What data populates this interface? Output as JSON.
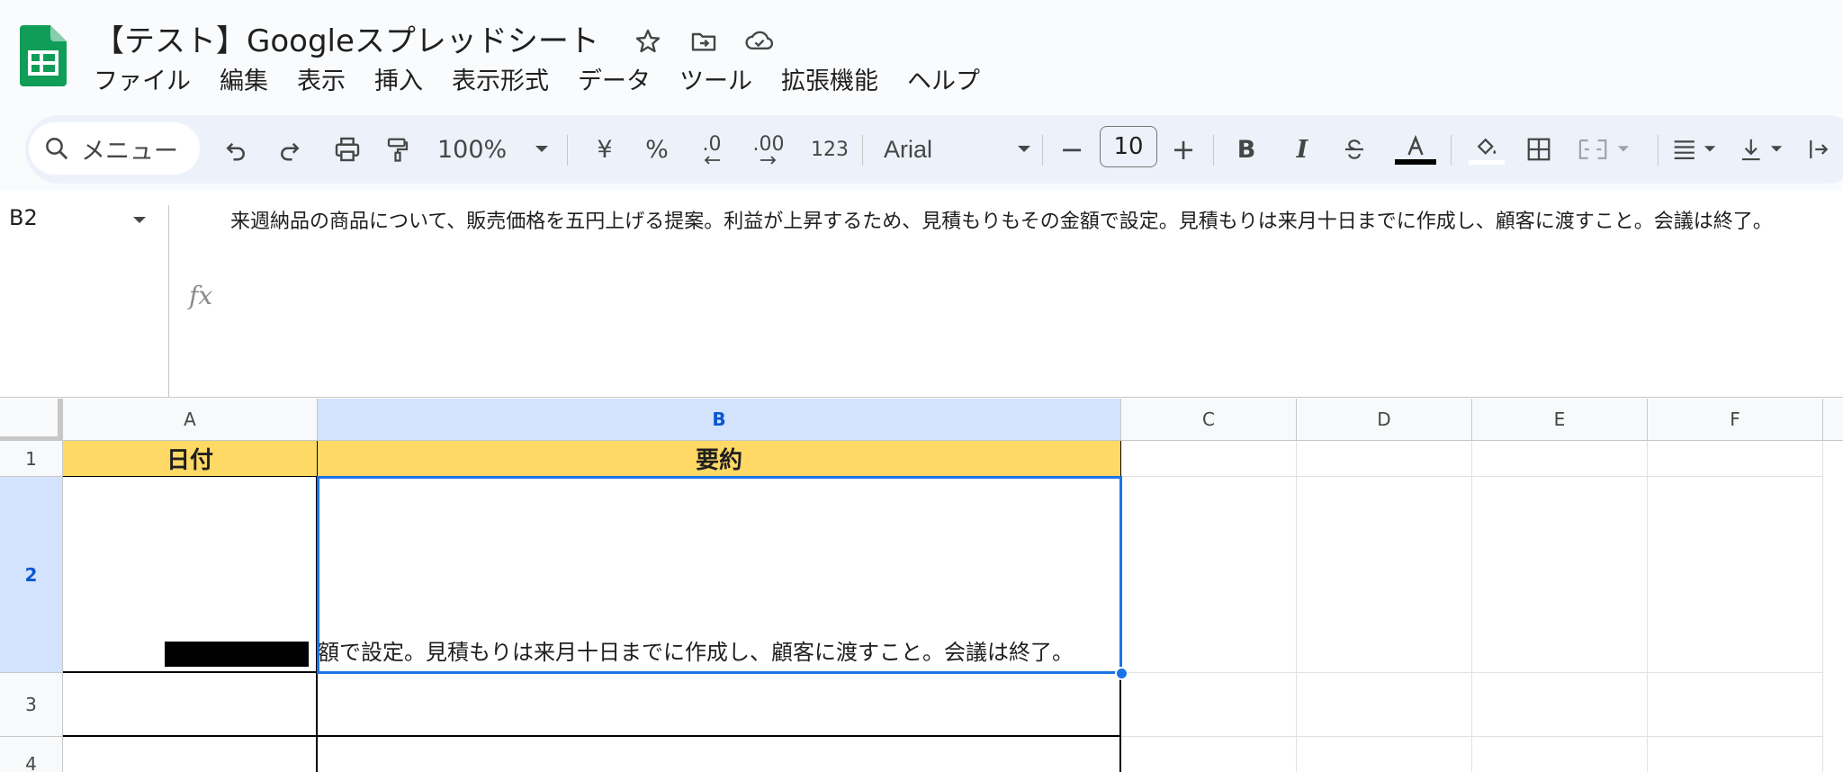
{
  "app": {
    "doc_title": "【テスト】Googleスプレッドシート",
    "brand_color": "#0f9d58"
  },
  "title_icons": [
    {
      "name": "star-icon"
    },
    {
      "name": "move-to-folder-icon"
    },
    {
      "name": "cloud-saved-icon"
    }
  ],
  "menu": [
    "ファイル",
    "編集",
    "表示",
    "挿入",
    "表示形式",
    "データ",
    "ツール",
    "拡張機能",
    "ヘルプ"
  ],
  "toolbar": {
    "search_placeholder": "メニュー",
    "zoom": "100%",
    "currency": "¥",
    "percent": "%",
    "decrease_decimal": ".0",
    "increase_decimal": ".00",
    "number_format": "123",
    "font": "Arial",
    "font_size": "10",
    "minus": "−",
    "plus": "+",
    "bold": "B",
    "italic": "I",
    "text_color": "#000000"
  },
  "formula_bar": {
    "cell_ref": "B2",
    "content": "来週納品の商品について、販売価格を五円上げる提案。利益が上昇するため、見積もりもその金額で設定。見積もりは来月十日までに作成し、顧客に渡すこと。会議は終了。"
  },
  "sheet": {
    "columns": [
      "A",
      "B",
      "C",
      "D",
      "E",
      "F"
    ],
    "rows": [
      "1",
      "2",
      "3",
      "4"
    ],
    "header_fill": "#ffd966",
    "selection_color": "#1a73e8",
    "cells": {
      "A1": "日付",
      "B1": "要約",
      "B2_visible": "額で設定。見積もりは来月十日までに作成し、顧客に渡すこと。会議は終了。"
    }
  }
}
